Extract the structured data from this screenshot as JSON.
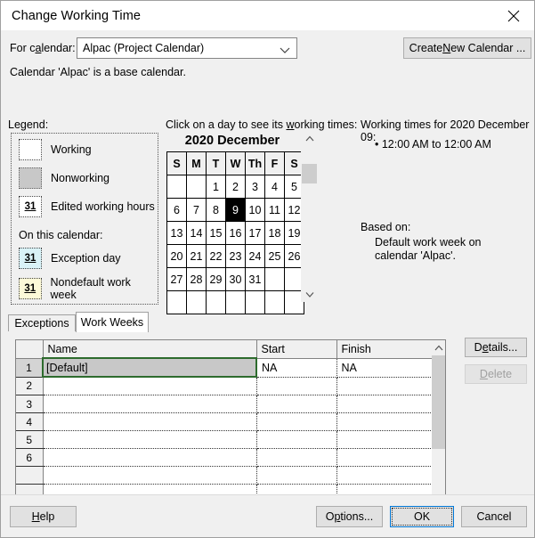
{
  "window": {
    "title": "Change Working Time",
    "close_icon": "close-icon"
  },
  "calendar_selector": {
    "label": "For calendar:",
    "label_prefix": "For c",
    "label_accel": "a",
    "label_suffix": "lendar:",
    "selected": "Alpac (Project Calendar)",
    "chevron_icon": "chevron-down-icon",
    "create_button_prefix": "Create ",
    "create_button_accel": "N",
    "create_button_suffix": "ew Calendar ...",
    "base_note": "Calendar 'Alpac' is a base calendar."
  },
  "legend": {
    "heading": "Legend:",
    "on_this_calendar": "On this calendar:",
    "items": [
      {
        "swatch": "working",
        "label": "Working",
        "badge": ""
      },
      {
        "swatch": "nonworking",
        "label": "Nonworking",
        "badge": ""
      },
      {
        "swatch": "edited",
        "label": "Edited working hours",
        "badge": "31"
      },
      {
        "swatch": "exception",
        "label": "Exception day",
        "badge": "31"
      },
      {
        "swatch": "nondefault",
        "label": "Nondefault work week",
        "badge": "31"
      }
    ],
    "colors": {
      "working": "#ffffff",
      "nonworking": "#c8c8c8",
      "edited": "#ffffff",
      "exception": "#d9f2f7",
      "nondefault": "#fcf9d8"
    }
  },
  "mini_calendar": {
    "hint_prefix": "Click on a day to see its ",
    "hint_accel": "w",
    "hint_suffix": "orking times:",
    "month_title": "2020 December",
    "weekdays": [
      "S",
      "M",
      "T",
      "W",
      "Th",
      "F",
      "S"
    ],
    "weeks": [
      [
        "",
        "",
        "1",
        "2",
        "3",
        "4",
        "5"
      ],
      [
        "6",
        "7",
        "8",
        "9",
        "10",
        "11",
        "12"
      ],
      [
        "13",
        "14",
        "15",
        "16",
        "17",
        "18",
        "19"
      ],
      [
        "20",
        "21",
        "22",
        "23",
        "24",
        "25",
        "26"
      ],
      [
        "27",
        "28",
        "29",
        "30",
        "31",
        "",
        ""
      ],
      [
        "",
        "",
        "",
        "",
        "",
        "",
        ""
      ]
    ],
    "selected_day": "9",
    "scroll_up_icon": "chevron-up-icon",
    "scroll_down_icon": "chevron-down-icon"
  },
  "working_times": {
    "title": "Working times for 2020 December 09:",
    "entries": [
      "12:00 AM to 12:00 AM"
    ],
    "based_on_label": "Based on:",
    "based_on_value": "Default work week on calendar 'Alpac'."
  },
  "tabs": [
    {
      "label": "Exceptions",
      "active": false
    },
    {
      "label": "Work Weeks",
      "active": true
    }
  ],
  "grid": {
    "columns": [
      "",
      "Name",
      "Start",
      "Finish"
    ],
    "rows": [
      {
        "num": "1",
        "name": "[Default]",
        "start": "NA",
        "finish": "NA",
        "selected": true
      },
      {
        "num": "2",
        "name": "",
        "start": "",
        "finish": "",
        "selected": false
      },
      {
        "num": "3",
        "name": "",
        "start": "",
        "finish": "",
        "selected": false
      },
      {
        "num": "4",
        "name": "",
        "start": "",
        "finish": "",
        "selected": false
      },
      {
        "num": "5",
        "name": "",
        "start": "",
        "finish": "",
        "selected": false
      },
      {
        "num": "6",
        "name": "",
        "start": "",
        "finish": "",
        "selected": false
      },
      {
        "num": "",
        "name": "",
        "start": "",
        "finish": "",
        "selected": false
      },
      {
        "num": "",
        "name": "",
        "start": "",
        "finish": "",
        "selected": false
      },
      {
        "num": "",
        "name": "",
        "start": "",
        "finish": "",
        "selected": false
      },
      {
        "num": "",
        "name": "",
        "start": "",
        "finish": "",
        "selected": false
      }
    ],
    "selection_border_color": "#2d6b2d",
    "scroll_up_icon": "chevron-up-icon",
    "scroll_down_icon": "chevron-down-icon"
  },
  "side_buttons": {
    "details_prefix": "D",
    "details_accel": "e",
    "details_suffix": "tails...",
    "delete_prefix": "",
    "delete_accel": "D",
    "delete_suffix": "elete",
    "delete_disabled": true
  },
  "footer": {
    "help_prefix": "",
    "help_accel": "H",
    "help_suffix": "elp",
    "options_prefix": "O",
    "options_accel": "p",
    "options_suffix": "tions...",
    "ok": "OK",
    "cancel": "Cancel",
    "focused": "OK"
  }
}
